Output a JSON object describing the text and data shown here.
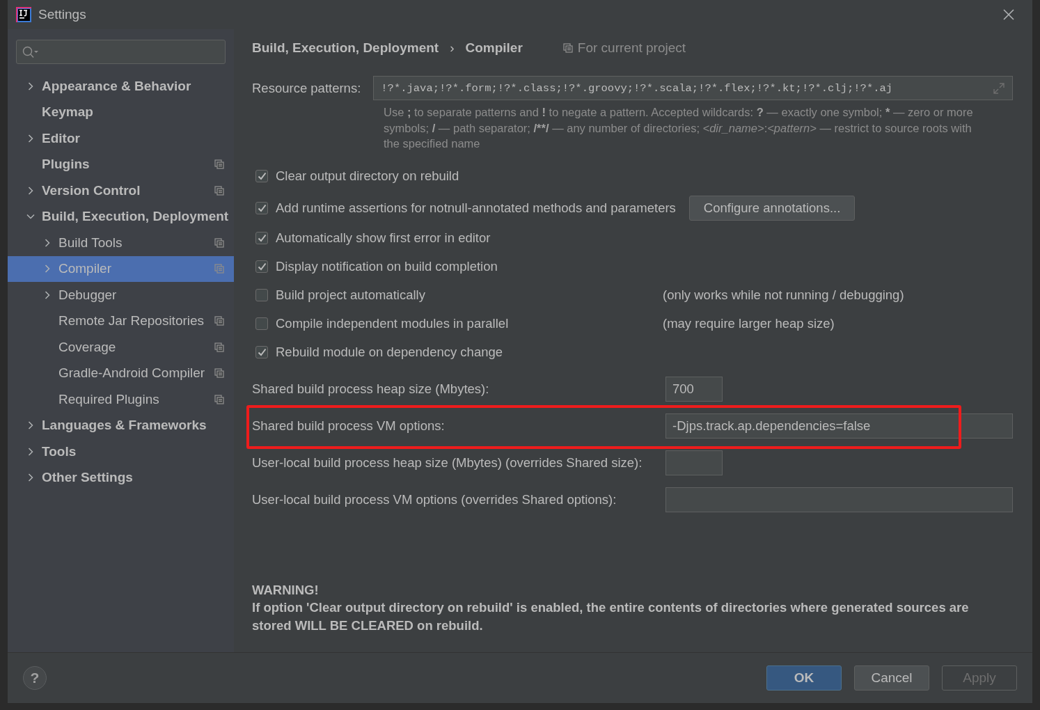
{
  "window": {
    "title": "Settings"
  },
  "sidebar": {
    "items": [
      {
        "label": "Appearance & Behavior",
        "kind": "collapsed",
        "project_scoped": false,
        "selected": false
      },
      {
        "label": "Keymap",
        "kind": "leaf",
        "project_scoped": false,
        "selected": false
      },
      {
        "label": "Editor",
        "kind": "collapsed",
        "project_scoped": false,
        "selected": false
      },
      {
        "label": "Plugins",
        "kind": "leaf",
        "project_scoped": true,
        "selected": false
      },
      {
        "label": "Version Control",
        "kind": "collapsed",
        "project_scoped": true,
        "selected": false
      },
      {
        "label": "Build, Execution, Deployment",
        "kind": "expanded",
        "project_scoped": false,
        "selected": false,
        "children": [
          {
            "label": "Build Tools",
            "kind": "collapsed",
            "project_scoped": true,
            "selected": false
          },
          {
            "label": "Compiler",
            "kind": "collapsed",
            "project_scoped": true,
            "selected": true
          },
          {
            "label": "Debugger",
            "kind": "collapsed",
            "project_scoped": false,
            "selected": false
          },
          {
            "label": "Remote Jar Repositories",
            "kind": "leaf",
            "project_scoped": true,
            "selected": false
          },
          {
            "label": "Coverage",
            "kind": "leaf",
            "project_scoped": true,
            "selected": false
          },
          {
            "label": "Gradle-Android Compiler",
            "kind": "leaf",
            "project_scoped": true,
            "selected": false
          },
          {
            "label": "Required Plugins",
            "kind": "leaf",
            "project_scoped": true,
            "selected": false
          }
        ]
      },
      {
        "label": "Languages & Frameworks",
        "kind": "collapsed",
        "project_scoped": false,
        "selected": false
      },
      {
        "label": "Tools",
        "kind": "collapsed",
        "project_scoped": false,
        "selected": false
      },
      {
        "label": "Other Settings",
        "kind": "collapsed",
        "project_scoped": false,
        "selected": false
      }
    ]
  },
  "breadcrumb": {
    "path": [
      "Build, Execution, Deployment",
      "Compiler"
    ],
    "separator": "›",
    "scope": "For current project"
  },
  "resource_patterns": {
    "label": "Resource patterns:",
    "value": "!?*.java;!?*.form;!?*.class;!?*.groovy;!?*.scala;!?*.flex;!?*.kt;!?*.clj;!?*.aj",
    "hint": [
      {
        "text": "Use ",
        "kind": "plain"
      },
      {
        "text": ";",
        "kind": "bold"
      },
      {
        "text": " to separate patterns and ",
        "kind": "plain"
      },
      {
        "text": "!",
        "kind": "bold"
      },
      {
        "text": " to negate a pattern. Accepted wildcards: ",
        "kind": "plain"
      },
      {
        "text": "?",
        "kind": "bold"
      },
      {
        "text": " — exactly one symbol; ",
        "kind": "plain"
      },
      {
        "text": "*",
        "kind": "bold"
      },
      {
        "text": " — zero or more symbols; ",
        "kind": "plain"
      },
      {
        "text": "/",
        "kind": "bold"
      },
      {
        "text": " — path separator; ",
        "kind": "plain"
      },
      {
        "text": "/**/",
        "kind": "bold"
      },
      {
        "text": " — any number of directories; ",
        "kind": "plain"
      },
      {
        "text": "<dir_name>",
        "kind": "italic"
      },
      {
        "text": ":",
        "kind": "plain"
      },
      {
        "text": "<pattern>",
        "kind": "italic"
      },
      {
        "text": " — restrict to source roots with the specified name",
        "kind": "plain"
      }
    ]
  },
  "options": [
    {
      "label": "Clear output directory on rebuild",
      "checked": true
    },
    {
      "label": "Add runtime assertions for notnull-annotated methods and parameters",
      "checked": true,
      "button": "Configure annotations..."
    },
    {
      "label": "Automatically show first error in editor",
      "checked": true
    },
    {
      "label": "Display notification on build completion",
      "checked": true
    },
    {
      "label": "Build project automatically",
      "checked": false,
      "note": "(only works while not running / debugging)"
    },
    {
      "label": "Compile independent modules in parallel",
      "checked": false,
      "note": "(may require larger heap size)"
    },
    {
      "label": "Rebuild module on dependency change",
      "checked": true
    }
  ],
  "fields": [
    {
      "label": "Shared build process heap size (Mbytes):",
      "value": "700",
      "kind": "short",
      "highlighted": false
    },
    {
      "label": "Shared build process VM options:",
      "value": "-Djps.track.ap.dependencies=false",
      "kind": "wide",
      "highlighted": true
    },
    {
      "label": "User-local build process heap size (Mbytes) (overrides Shared size):",
      "kind": "short",
      "highlighted": false
    },
    {
      "label": "User-local build process VM options (overrides Shared options):",
      "kind": "wide",
      "highlighted": false
    }
  ],
  "warning": {
    "title": "WARNING!",
    "text": "If option 'Clear output directory on rebuild' is enabled, the entire contents of directories where generated sources are stored WILL BE CLEARED on rebuild."
  },
  "footer": {
    "help": "?",
    "buttons": [
      {
        "label": "OK",
        "kind": "default",
        "disabled": false
      },
      {
        "label": "Cancel",
        "kind": "normal",
        "disabled": false
      },
      {
        "label": "Apply",
        "kind": "normal",
        "disabled": true
      }
    ]
  }
}
